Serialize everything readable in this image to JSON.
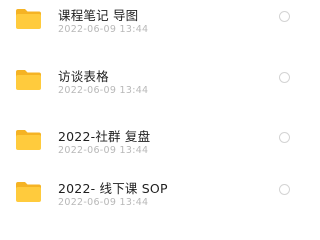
{
  "icons": {
    "folder": "folder-icon",
    "select": "radio-circle-icon"
  },
  "colors": {
    "folder_front": "#FFCB3D",
    "folder_back": "#F5B324",
    "name_text": "#1F1F1F",
    "date_text": "#B8B8B8"
  },
  "files": [
    {
      "name": "课程笔记 导图",
      "date": "2022-06-09 13:44"
    },
    {
      "name": "访谈表格",
      "date": "2022-06-09 13:44"
    },
    {
      "name": "2022-社群 复盘",
      "date": "2022-06-09 13:44"
    },
    {
      "name": "2022- 线下课 SOP",
      "date": "2022-06-09 13:44"
    }
  ]
}
